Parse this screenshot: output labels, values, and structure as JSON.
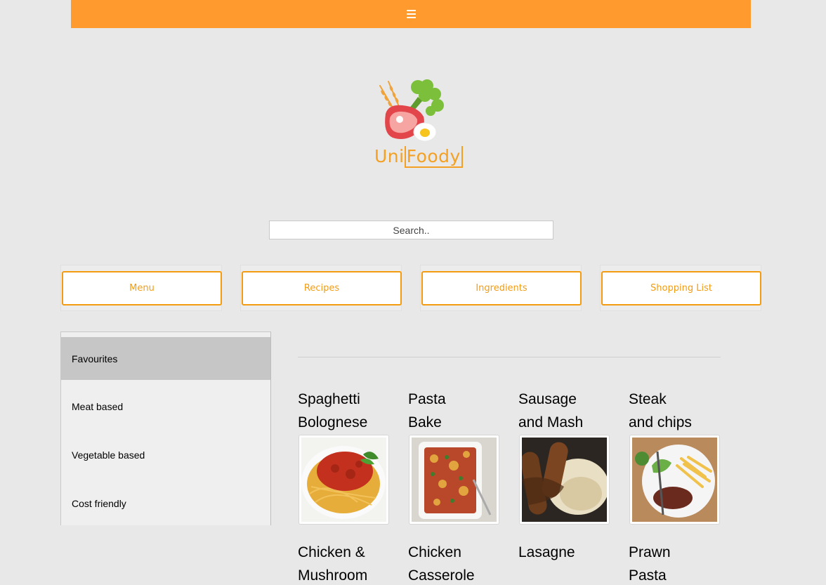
{
  "header": {
    "menu_icon": "hamburger-icon",
    "accent": "#ff9a2e"
  },
  "brand": {
    "name_part1": "Uni",
    "name_part2": "Foody"
  },
  "search": {
    "placeholder": "Search..",
    "value": ""
  },
  "nav": {
    "menu": "Menu",
    "recipes": "Recipes",
    "ingredients": "Ingredients",
    "shopping_list": "Shopping List"
  },
  "sidebar": {
    "items": [
      {
        "label": "Favourites",
        "active": true
      },
      {
        "label": "Meat based",
        "active": false
      },
      {
        "label": "Vegetable based",
        "active": false
      },
      {
        "label": "Cost friendly",
        "active": false
      }
    ]
  },
  "recipes": [
    {
      "title_line1": "Spaghetti",
      "title_line2": "Bolognese"
    },
    {
      "title_line1": "Pasta",
      "title_line2": "Bake"
    },
    {
      "title_line1": "Sausage",
      "title_line2": "and Mash"
    },
    {
      "title_line1": "Steak",
      "title_line2": "and chips"
    },
    {
      "title_line1": "Chicken &",
      "title_line2": "Mushroom"
    },
    {
      "title_line1": "Chicken",
      "title_line2": "Casserole"
    },
    {
      "title_line1": "Lasagne",
      "title_line2": ""
    },
    {
      "title_line1": "Prawn",
      "title_line2": "Pasta"
    }
  ]
}
